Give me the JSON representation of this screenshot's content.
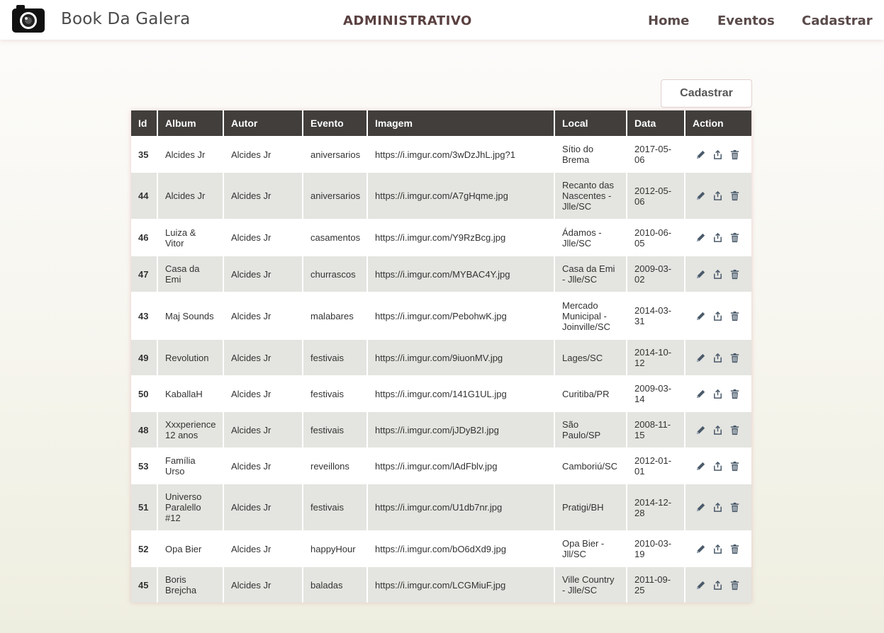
{
  "nav": {
    "brand": "Book Da Galera",
    "center": "ADMINISTRATIVO",
    "links": [
      "Home",
      "Eventos",
      "Cadastrar"
    ]
  },
  "cadastrar_button": "Cadastrar",
  "table": {
    "headers": [
      "Id",
      "Album",
      "Autor",
      "Evento",
      "Imagem",
      "Local",
      "Data",
      "Action"
    ],
    "rows": [
      [
        "35",
        "Alcides Jr",
        "Alcides Jr",
        "aniversarios",
        "https://i.imgur.com/3wDzJhL.jpg?1",
        "Sítio do Brema",
        "2017-05-06"
      ],
      [
        "44",
        "Alcides Jr",
        "Alcides Jr",
        "aniversarios",
        "https://i.imgur.com/A7gHqme.jpg",
        "Recanto das Nascentes - Jlle/SC",
        "2012-05-06"
      ],
      [
        "46",
        "Luiza & Vitor",
        "Alcides Jr",
        "casamentos",
        "https://i.imgur.com/Y9RzBcg.jpg",
        "Ádamos - Jlle/SC",
        "2010-06-05"
      ],
      [
        "47",
        "Casa da Emi",
        "Alcides Jr",
        "churrascos",
        "https://i.imgur.com/MYBAC4Y.jpg",
        "Casa da Emi - Jlle/SC",
        "2009-03-02"
      ],
      [
        "43",
        "Maj Sounds",
        "Alcides Jr",
        "malabares",
        "https://i.imgur.com/PebohwK.jpg",
        "Mercado Municipal - Joinville/SC",
        "2014-03-31"
      ],
      [
        "49",
        "Revolution",
        "Alcides Jr",
        "festivais",
        "https://i.imgur.com/9iuonMV.jpg",
        "Lages/SC",
        "2014-10-12"
      ],
      [
        "50",
        "KaballaH",
        "Alcides Jr",
        "festivais",
        "https://i.imgur.com/141G1UL.jpg",
        "Curitiba/PR",
        "2009-03-14"
      ],
      [
        "48",
        "Xxxperience 12 anos",
        "Alcides Jr",
        "festivais",
        "https://i.imgur.com/jJDyB2I.jpg",
        "São Paulo/SP",
        "2008-11-15"
      ],
      [
        "53",
        "Família Urso",
        "Alcides Jr",
        "reveillons",
        "https://i.imgur.com/lAdFblv.jpg",
        "Camboriú/SC",
        "2012-01-01"
      ],
      [
        "51",
        "Universo Paralello #12",
        "Alcides Jr",
        "festivais",
        "https://i.imgur.com/U1db7nr.jpg",
        "Pratigi/BH",
        "2014-12-28"
      ],
      [
        "52",
        "Opa Bier",
        "Alcides Jr",
        "happyHour",
        "https://i.imgur.com/bO6dXd9.jpg",
        "Opa Bier - Jll/SC",
        "2010-03-19"
      ],
      [
        "45",
        "Boris Brejcha",
        "Alcides Jr",
        "baladas",
        "https://i.imgur.com/LCGMiuF.jpg",
        "Ville Country - Jlle/SC",
        "2011-09-25"
      ]
    ]
  },
  "icons": {
    "brand": "camera-icon",
    "edit": "pencil-icon",
    "share": "share-icon",
    "delete": "trash-icon"
  },
  "colors": {
    "header_bg": "#413e3c",
    "row_even": "#e4e4e0",
    "icon": "#4a5a6a"
  }
}
